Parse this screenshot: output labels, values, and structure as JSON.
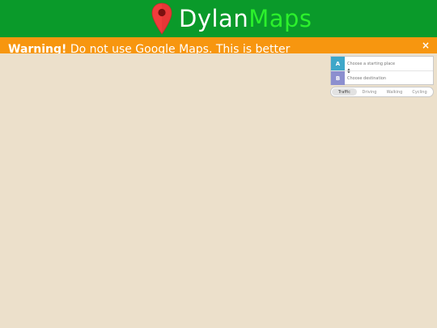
{
  "header": {
    "brand_first": "Dylan",
    "brand_second": "Maps",
    "pin_color": "#f03c3c",
    "bg_color": "#0a9a2a"
  },
  "warning": {
    "label": "Warning!",
    "message": "Do not use Google Maps. This is better",
    "close": "×",
    "bg_color": "#f7960f"
  },
  "route": {
    "start_badge": "A",
    "start_placeholder": "Choose a starting place",
    "dest_badge": "B",
    "dest_placeholder": "Choose destination",
    "swap_icon": "swap-vertical-icon"
  },
  "modes": [
    {
      "label": "Traffic",
      "active": true
    },
    {
      "label": "Driving",
      "active": false
    },
    {
      "label": "Walking",
      "active": false
    },
    {
      "label": "Cycling",
      "active": false
    }
  ],
  "map": {
    "bg_color": "#ece0cb"
  }
}
